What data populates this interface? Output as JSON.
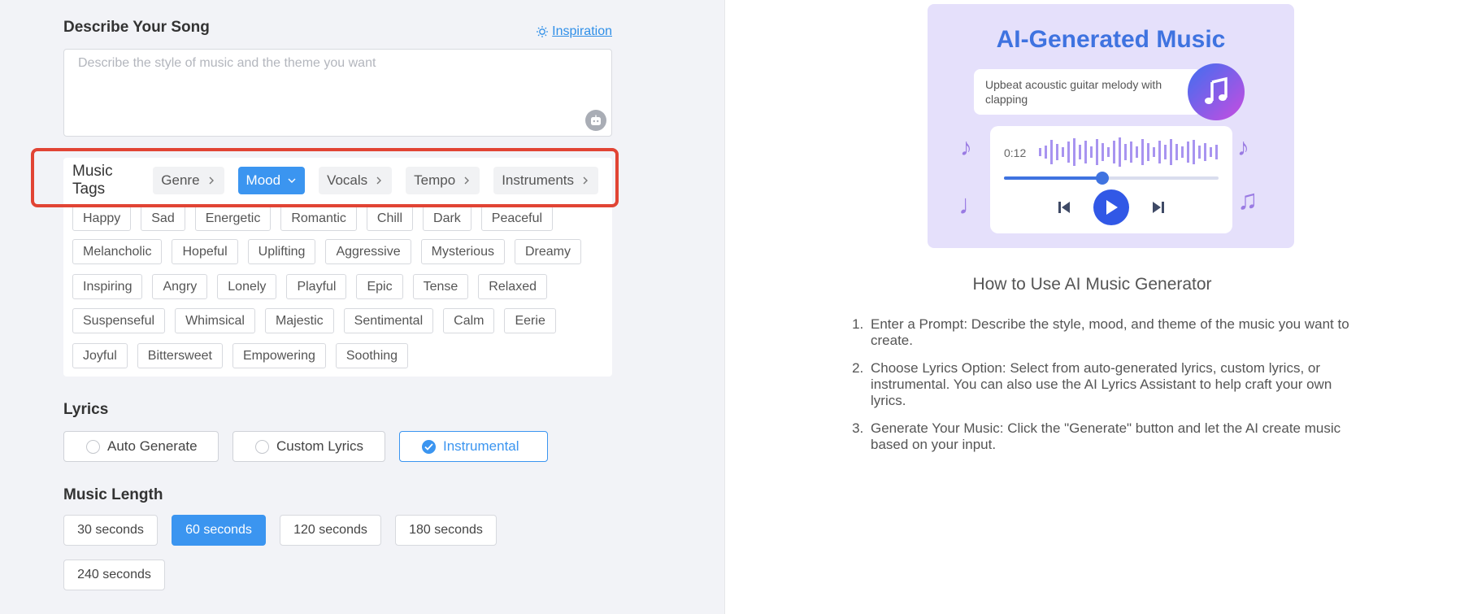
{
  "form": {
    "describe_title": "Describe Your Song",
    "inspiration_label": "Inspiration",
    "prompt_placeholder": "Describe the style of music and the theme you want",
    "prompt_value": ""
  },
  "tags": {
    "label": "Music Tags",
    "categories": [
      "Genre",
      "Mood",
      "Vocals",
      "Tempo",
      "Instruments"
    ],
    "active_category": "Mood",
    "mood_rows": [
      [
        "Happy",
        "Sad",
        "Energetic",
        "Romantic",
        "Chill",
        "Dark",
        "Peaceful"
      ],
      [
        "Melancholic",
        "Hopeful",
        "Uplifting",
        "Aggressive",
        "Mysterious",
        "Dreamy"
      ],
      [
        "Inspiring",
        "Angry",
        "Lonely",
        "Playful",
        "Epic",
        "Tense",
        "Relaxed"
      ],
      [
        "Suspenseful",
        "Whimsical",
        "Majestic",
        "Sentimental",
        "Calm",
        "Eerie"
      ],
      [
        "Joyful",
        "Bittersweet",
        "Empowering",
        "Soothing"
      ]
    ]
  },
  "lyrics": {
    "title": "Lyrics",
    "options": [
      "Auto Generate",
      "Custom Lyrics",
      "Instrumental"
    ],
    "selected": "Instrumental"
  },
  "length": {
    "title": "Music Length",
    "options": [
      "30 seconds",
      "60 seconds",
      "120 seconds",
      "180 seconds",
      "240 seconds"
    ],
    "selected": "60 seconds"
  },
  "illustration": {
    "title": "AI-Generated Music",
    "prompt_text": "Upbeat acoustic guitar melody with clapping",
    "time": "0:12",
    "progress": 0.46
  },
  "howto": {
    "title": "How to Use AI Music Generator",
    "steps": [
      "Enter a Prompt: Describe the style, mood, and theme of the music you want to create.",
      "Choose Lyrics Option: Select from auto-generated lyrics, custom lyrics, or instrumental. You can also use the AI Lyrics Assistant to help craft your own lyrics.",
      "Generate Your Music: Click the \"Generate\" button and let the AI create music based on your input."
    ]
  },
  "colors": {
    "accent": "#3b95f0",
    "highlight": "#e14434",
    "panel_bg": "#f2f3f7"
  }
}
